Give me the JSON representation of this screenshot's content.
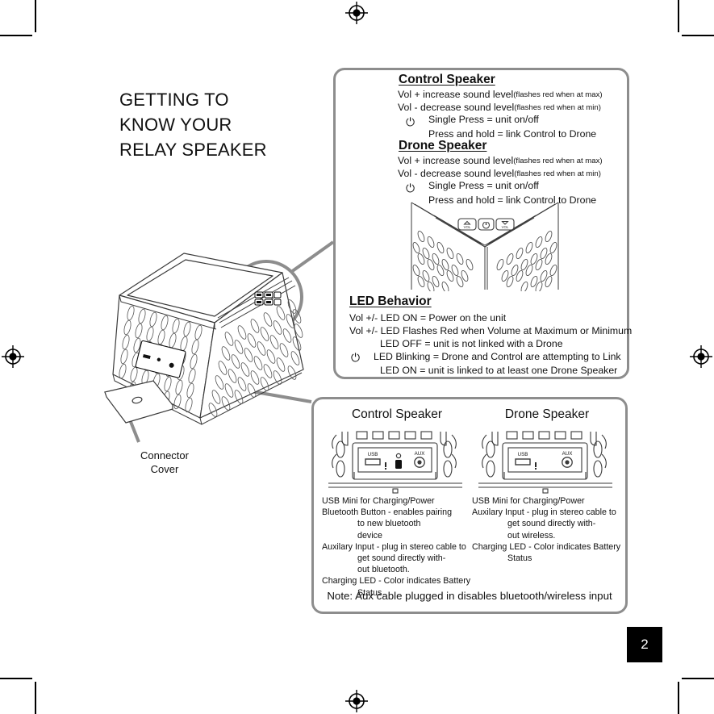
{
  "page": {
    "number": "2"
  },
  "headline": {
    "lines": [
      "GETTING TO",
      "KNOW YOUR",
      "RELAY SPEAKER"
    ]
  },
  "top_panel": {
    "control": {
      "title": "Control Speaker",
      "rows": [
        {
          "icon": "",
          "main": "Vol + increase sound  level ",
          "note": "(flashes red when at max)"
        },
        {
          "icon": "",
          "main": "Vol -  decrease sound level ",
          "note": "(flashes red when at min)"
        },
        {
          "icon": "power-icon",
          "main": "Single Press = unit on/off",
          "note": ""
        },
        {
          "icon": "",
          "main": "Press and hold = link Control to Drone",
          "note": ""
        }
      ]
    },
    "drone": {
      "title": "Drone Speaker",
      "rows": [
        {
          "icon": "",
          "main": "Vol + increase sound level ",
          "note": "(flashes red when at max)"
        },
        {
          "icon": "",
          "main": "Vol -  decrease sound level",
          "note": "(flashes red when at min)"
        },
        {
          "icon": "power-icon",
          "main": "Single Press = unit on/off",
          "note": ""
        },
        {
          "icon": "",
          "main": "Press and hold = link Control to Drone",
          "note": ""
        }
      ]
    },
    "button_art": {
      "vol_up_label": "VOL",
      "power_label": "power-icon",
      "vol_down_label": "VOL"
    },
    "led": {
      "title": "LED Behavior",
      "rows": [
        {
          "icon": "",
          "indent": 0,
          "text": "Vol +/- LED ON = Power on the unit"
        },
        {
          "icon": "",
          "indent": 0,
          "text": "Vol +/- LED Flashes Red when Volume at Maximum or Minimum"
        },
        {
          "icon": "",
          "indent": 1,
          "text": "LED OFF = unit is not linked with a Drone"
        },
        {
          "icon": "power-icon",
          "indent": 2,
          "text": "LED Blinking = Drone and Control are attempting to Link"
        },
        {
          "icon": "",
          "indent": 1,
          "text": "LED ON = unit is linked to at least one Drone Speaker"
        }
      ]
    }
  },
  "bottom_panel": {
    "left": {
      "title": "Control Speaker",
      "ports": {
        "usb": "USB",
        "aux": "AUX"
      },
      "items": [
        {
          "text": "USB Mini for Charging/Power",
          "hang": false
        },
        {
          "text": "Bluetooth Button - enables pairing",
          "hang": false
        },
        {
          "text": "to new bluetooth",
          "hang": true
        },
        {
          "text": "device",
          "hang": true
        },
        {
          "text": "Auxilary Input - plug in stereo cable to",
          "hang": false
        },
        {
          "text": "get sound directly with-",
          "hang": true
        },
        {
          "text": "out bluetooth.",
          "hang": true
        },
        {
          "text": "Charging LED - Color indicates Battery",
          "hang": false
        },
        {
          "text": "Status",
          "hang": true
        }
      ]
    },
    "right": {
      "title": "Drone Speaker",
      "ports": {
        "usb": "USB",
        "aux": "AUX"
      },
      "items": [
        {
          "text": "USB Mini for Charging/Power",
          "hang": false
        },
        {
          "text": "Auxilary Input - plug in stereo cable to",
          "hang": false
        },
        {
          "text": "get sound directly with-",
          "hang": true
        },
        {
          "text": "out wireless.",
          "hang": true
        },
        {
          "text": "Charging LED - Color indicates Battery",
          "hang": false
        },
        {
          "text": "Status",
          "hang": true
        }
      ]
    },
    "note": "Note: Aux cable plugged in disables bluetooth/wireless input"
  },
  "illustration": {
    "connector_cover_label": [
      "Connector",
      "Cover"
    ]
  },
  "colors": {
    "panel_border": "#8d8d8d",
    "leader_line": "#8d8d8d",
    "art_line": "#3a3a3a",
    "text": "#111111",
    "page_badge_bg": "#000000",
    "page_badge_fg": "#ffffff"
  }
}
